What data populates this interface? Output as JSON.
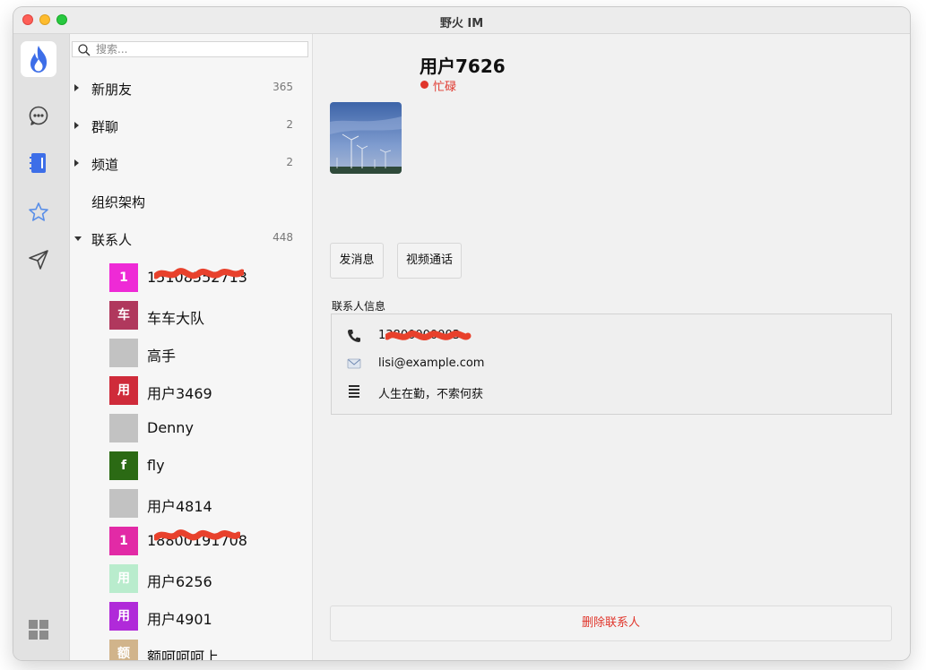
{
  "window": {
    "title": "野火 IM"
  },
  "search": {
    "placeholder": "搜索..."
  },
  "groups": [
    {
      "label": "新朋友",
      "count": "365",
      "expanded": false
    },
    {
      "label": "群聊",
      "count": "2",
      "expanded": false
    },
    {
      "label": "频道",
      "count": "2",
      "expanded": false
    },
    {
      "label": "组织架构",
      "count": "",
      "expanded": null
    },
    {
      "label": "联系人",
      "count": "448",
      "expanded": true
    }
  ],
  "contacts": [
    {
      "name": "15108552713",
      "avatar_text": "1",
      "avatar_color": "#ee2ad6",
      "redacted": true
    },
    {
      "name": "车车大队",
      "avatar_text": "车",
      "avatar_color": "#b0385d"
    },
    {
      "name": "高手",
      "avatar_text": "",
      "avatar_color": "#c2c2c2"
    },
    {
      "name": "用户3469",
      "avatar_text": "用",
      "avatar_color": "#cf2b3a"
    },
    {
      "name": "Denny",
      "avatar_text": "",
      "avatar_color": "#c2c2c2"
    },
    {
      "name": "fly",
      "avatar_text": "f",
      "avatar_color": "#2b6a14"
    },
    {
      "name": "用户4814",
      "avatar_text": "",
      "avatar_color": "#c2c2c2"
    },
    {
      "name": "18800191708",
      "avatar_text": "1",
      "avatar_color": "#e22aa6",
      "redacted": true
    },
    {
      "name": "用户6256",
      "avatar_text": "用",
      "avatar_color": "#b9eccd"
    },
    {
      "name": "用户4901",
      "avatar_text": "用",
      "avatar_color": "#b02ad9"
    },
    {
      "name": "额呵呵呵上",
      "avatar_text": "额",
      "avatar_color": "#d1b48b"
    }
  ],
  "detail": {
    "name": "用户7626",
    "status": "忙碌",
    "status_color": "#e0352b",
    "send_message": "发消息",
    "video_call": "视频通话",
    "info_title": "联系人信息",
    "phone": "13800000003",
    "email": "lisi@example.com",
    "signature": "人生在勤，不索何获",
    "delete": "删除联系人"
  },
  "icons": {
    "app_logo": "flame-icon",
    "chat": "chat-bubble-icon",
    "contacts": "contacts-book-icon",
    "favorites": "star-icon",
    "discover": "send-icon",
    "apps": "grid-icon"
  },
  "colors": {
    "accent": "#3d6ee8",
    "danger": "#e0352b"
  }
}
